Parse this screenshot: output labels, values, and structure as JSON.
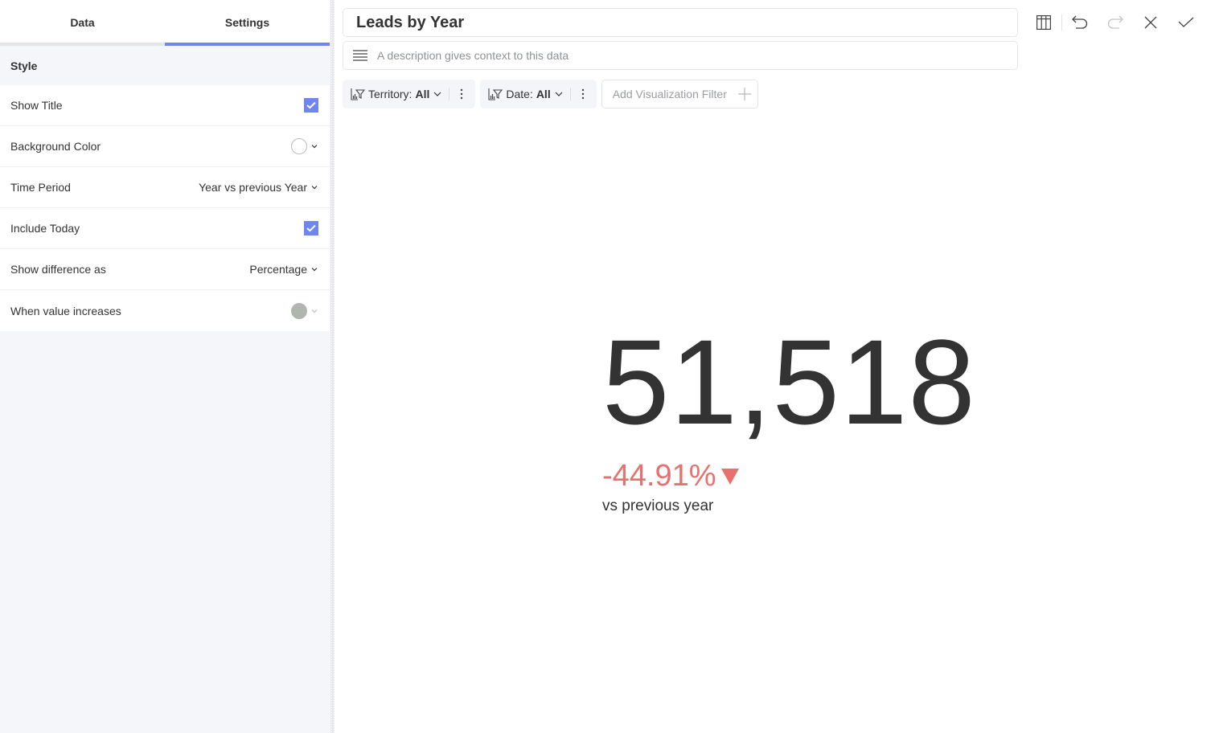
{
  "left_panel": {
    "tabs": [
      {
        "label": "Data",
        "active": false
      },
      {
        "label": "Settings",
        "active": true
      }
    ],
    "section_title": "Style",
    "settings": {
      "show_title": {
        "label": "Show Title",
        "checked": true
      },
      "background_color": {
        "label": "Background Color",
        "value": "white-outline",
        "icon": "color-swatch-icon"
      },
      "time_period": {
        "label": "Time Period",
        "value": "Year vs previous Year"
      },
      "include_today": {
        "label": "Include Today",
        "checked": true
      },
      "show_difference_as": {
        "label": "Show difference as",
        "value": "Percentage"
      },
      "when_value_increases": {
        "label": "When value increases",
        "value": "#b0b5b0"
      }
    }
  },
  "header": {
    "title": "Leads by Year",
    "description_placeholder": "A description gives context to this data"
  },
  "toolbar": {
    "buttons": [
      "table-view",
      "undo",
      "redo",
      "close",
      "confirm"
    ]
  },
  "filters": [
    {
      "name": "Territory:",
      "value": "All"
    },
    {
      "name": "Date:",
      "value": "All"
    }
  ],
  "add_filter_label": "Add Visualization Filter",
  "kpi": {
    "value": "51,518",
    "difference": "-44.91%",
    "direction": "down",
    "caption": "vs previous year"
  },
  "colors": {
    "accent": "#6e86ee",
    "negative": "#e8706e",
    "text": "#333333"
  }
}
